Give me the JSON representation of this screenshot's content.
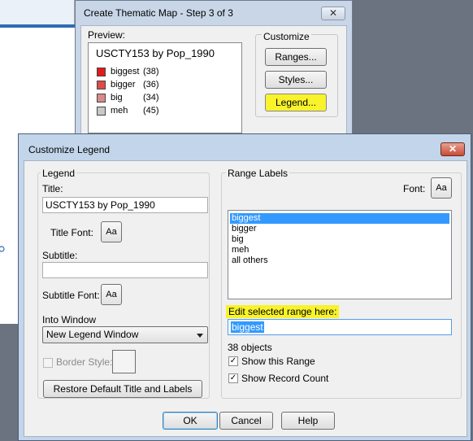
{
  "parent_window": {
    "title": "Create Thematic Map - Step 3 of 3",
    "close_glyph": "✕",
    "preview_label": "Preview:",
    "preview_title": "USCTY153 by Pop_1990",
    "preview_rows": [
      {
        "name": "biggest",
        "count": "(38)",
        "color": "#e31a1c"
      },
      {
        "name": "bigger",
        "count": "(36)",
        "color": "#e14a4a"
      },
      {
        "name": "big",
        "count": "(34)",
        "color": "#d98a8a"
      },
      {
        "name": "meh",
        "count": "(45)",
        "color": "#c8c8c8"
      }
    ],
    "customize_label": "Customize",
    "ranges_button": "Ranges...",
    "styles_button": "Styles...",
    "legend_button": "Legend..."
  },
  "dialog": {
    "title": "Customize Legend",
    "close_glyph": "✕",
    "legend_group": "Legend",
    "title_label": "Title:",
    "title_value": "USCTY153 by Pop_1990",
    "title_font_label": "Title Font:",
    "font_button": "Aa",
    "subtitle_label": "Subtitle:",
    "subtitle_value": "",
    "subtitle_font_label": "Subtitle Font:",
    "into_window_label": "Into Window",
    "into_window_value": "New Legend Window",
    "border_style_label": "Border Style:",
    "restore_button": "Restore Default Title and Labels",
    "range_labels_group": "Range Labels",
    "font_label": "Font:",
    "range_items": [
      "biggest",
      "bigger",
      "big",
      "meh",
      "all others"
    ],
    "selected_index": 0,
    "edit_range_label": "Edit selected range here:",
    "edit_range_value": "biggest",
    "objects_count": "38 objects",
    "show_range_label": "Show this Range",
    "show_record_count_label": "Show Record Count",
    "ok_button": "OK",
    "cancel_button": "Cancel",
    "help_button": "Help"
  },
  "colors": {
    "highlight": "#f8f32b",
    "selection": "#3399ff"
  }
}
